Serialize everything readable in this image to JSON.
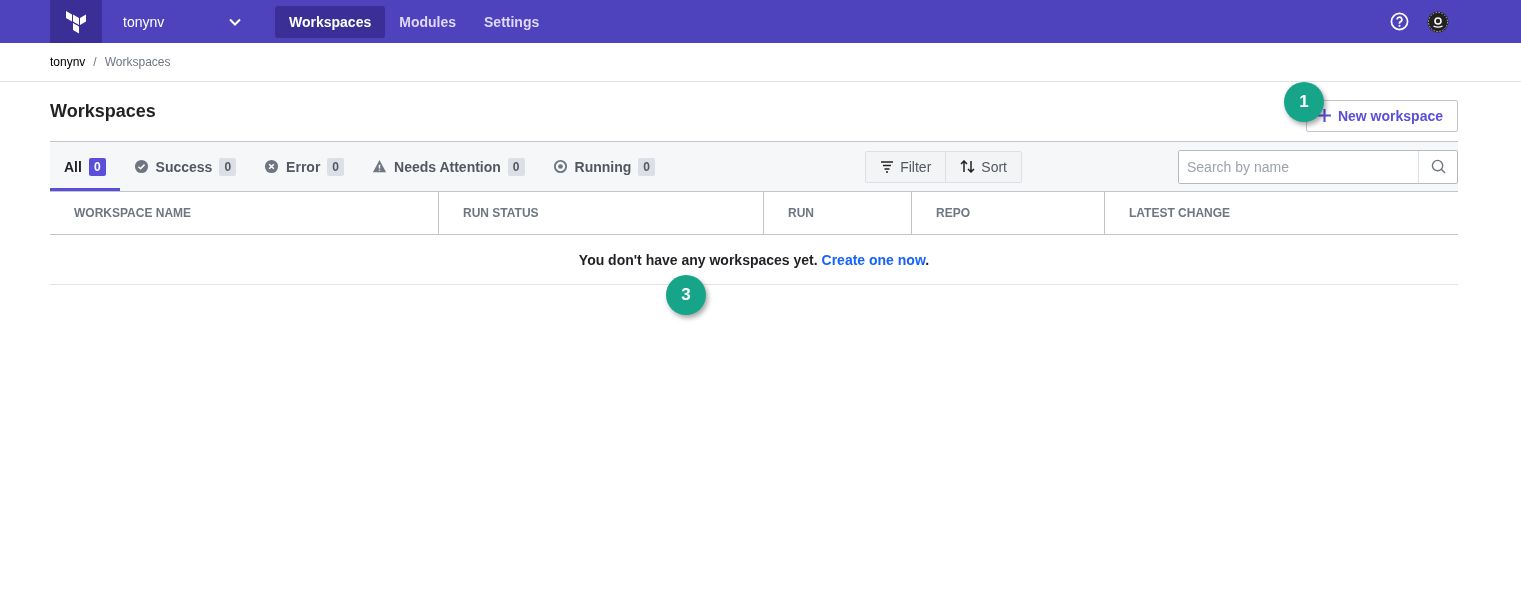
{
  "header": {
    "org": "tonynv",
    "nav": [
      {
        "label": "Workspaces",
        "selected": true
      },
      {
        "label": "Modules",
        "selected": false
      },
      {
        "label": "Settings",
        "selected": false
      }
    ]
  },
  "breadcrumb": {
    "items": [
      {
        "label": "tonynv",
        "current": false
      },
      {
        "label": "Workspaces",
        "current": true
      }
    ],
    "separator": "/"
  },
  "page": {
    "title": "Workspaces",
    "new_button": {
      "label": "New workspace",
      "callout": "1"
    }
  },
  "filter_tabs": [
    {
      "label": "All",
      "kind": "all",
      "count": "0",
      "selected": true
    },
    {
      "label": "Success",
      "kind": "success",
      "count": "0",
      "selected": false
    },
    {
      "label": "Error",
      "kind": "error",
      "count": "0",
      "selected": false
    },
    {
      "label": "Needs Attention",
      "kind": "attention",
      "count": "0",
      "selected": false
    },
    {
      "label": "Running",
      "kind": "running",
      "count": "0",
      "selected": false
    }
  ],
  "toolbar": {
    "filter": "Filter",
    "sort": "Sort",
    "search": {
      "placeholder": "Search by name"
    }
  },
  "table": {
    "columns": [
      "WORKSPACE NAME",
      "RUN STATUS",
      "RUN",
      "REPO",
      "LATEST CHANGE"
    ],
    "empty": {
      "text": "You don't have any workspaces yet. ",
      "link": "Create one now",
      "end": ".",
      "callout": "3"
    }
  }
}
